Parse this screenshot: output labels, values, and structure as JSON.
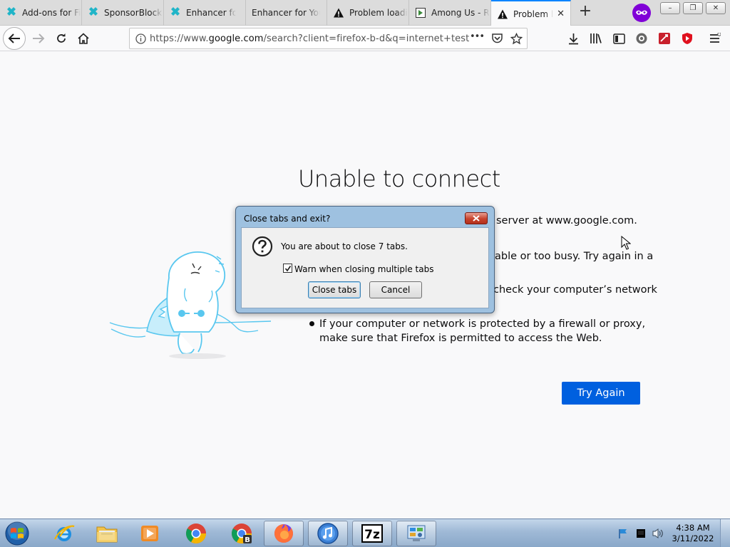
{
  "browser": {
    "tabs": [
      {
        "label": "Add-ons for Firefox",
        "icon": "addons-icon",
        "active": false
      },
      {
        "label": "SponsorBlock",
        "icon": "sponsorblock-icon",
        "active": false
      },
      {
        "label": "Enhancer for YouTube",
        "icon": "enhancer-icon",
        "active": false
      },
      {
        "label": "Enhancer for YouTube",
        "icon": "none",
        "active": false
      },
      {
        "label": "Problem loading page",
        "icon": "warning-icon",
        "active": false
      },
      {
        "label": "Among Us - Reddit",
        "icon": "page-icon",
        "active": false
      },
      {
        "label": "Problem loading page",
        "icon": "warning-icon",
        "active": true
      }
    ],
    "new_tab_symbol": "+",
    "window_controls": {
      "minimize": "–",
      "maximize": "❐",
      "close": "✕"
    },
    "url": {
      "prefix": "https://www.",
      "host": "google.com",
      "path": "/search?client=firefox-b-d&q=internet+test"
    },
    "page_actions_symbol": "•••"
  },
  "error_page": {
    "title": "Unable to connect",
    "lines": [
      "server at www.google.com.",
      "able or too busy. Try again in a",
      "check your computer’s network",
      "If your computer or network is protected by a firewall or proxy,",
      "make sure that Firefox is permitted to access the Web."
    ],
    "try_again_label": "Try Again"
  },
  "dialog": {
    "title": "Close tabs and exit?",
    "message": "You are about to close 7 tabs.",
    "checkbox_label": "Warn when closing multiple tabs",
    "checkbox_checked": true,
    "close_tabs_label": "Close tabs",
    "cancel_label": "Cancel"
  },
  "taskbar": {
    "items": [
      {
        "name": "internet-explorer",
        "open": false
      },
      {
        "name": "windows-explorer",
        "open": false
      },
      {
        "name": "media-player",
        "open": false
      },
      {
        "name": "chrome",
        "open": false
      },
      {
        "name": "chrome-profile-b",
        "open": false
      },
      {
        "name": "firefox",
        "open": true
      },
      {
        "name": "itunes",
        "open": true
      },
      {
        "name": "7zip",
        "open": true
      },
      {
        "name": "control-panel",
        "open": true
      }
    ],
    "clock": {
      "time": "4:38 AM",
      "date": "3/11/2022"
    }
  },
  "colors": {
    "accent": "#0a84ff",
    "try_again_bg": "#0060df",
    "private_badge": "#8000d7",
    "dino_line": "#59c7ef"
  }
}
